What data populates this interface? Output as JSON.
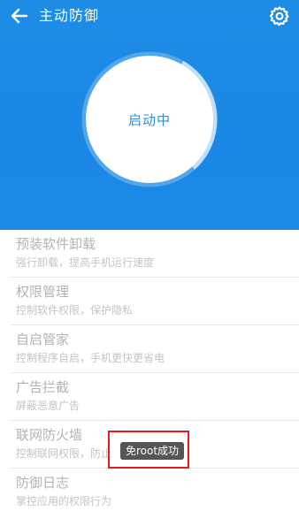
{
  "app": {
    "title": "主动防御"
  },
  "icons": {
    "back": "back-arrow-icon",
    "settings": "gear-icon"
  },
  "status_ring": {
    "label": "启动中",
    "progress": 0.3
  },
  "features": [
    {
      "title": "预装软件卸载",
      "desc": "强行卸载，提高手机运行速度"
    },
    {
      "title": "权限管理",
      "desc": "控制软件权限，保护隐私"
    },
    {
      "title": "自启管家",
      "desc": "控制程序自启，手机更快更省电"
    },
    {
      "title": "广告拦截",
      "desc": "屏蔽恶意广告"
    },
    {
      "title": "联网防火墙",
      "desc": "控制联网权限，防止"
    },
    {
      "title": "防御日志",
      "desc": "掌控应用的权限行为"
    }
  ],
  "toast": {
    "text": "免root成功"
  },
  "colors": {
    "header_blue": "#1a87e4",
    "accent_blue": "#2a8ee4",
    "highlight_red": "#e31b1b"
  }
}
